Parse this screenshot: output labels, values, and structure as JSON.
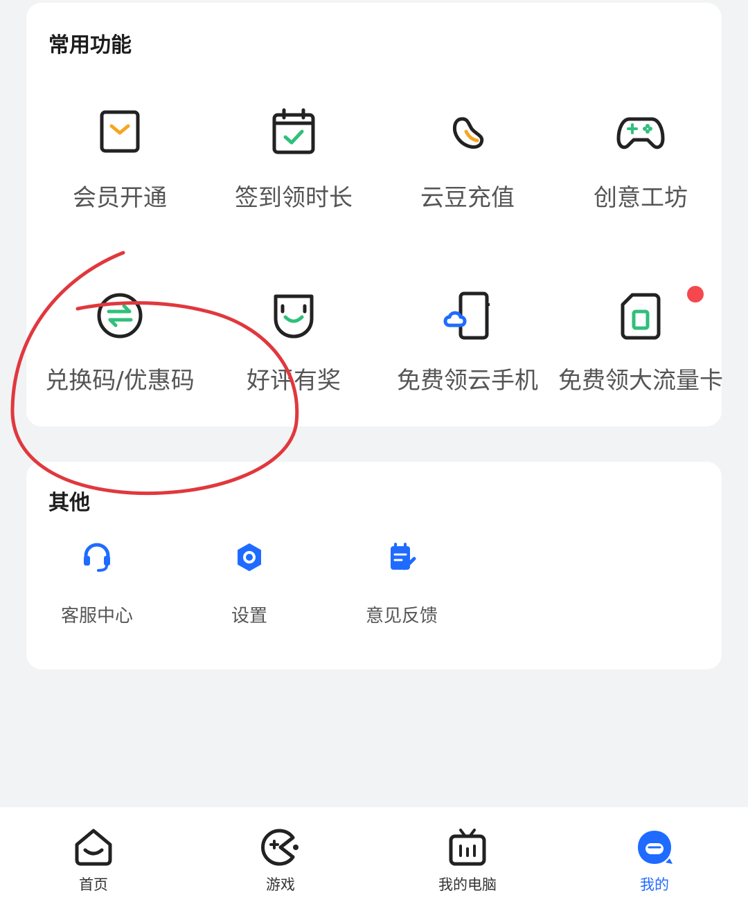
{
  "common": {
    "title": "常用功能",
    "items": [
      {
        "label": "会员开通",
        "icon": "vip-icon"
      },
      {
        "label": "签到领时长",
        "icon": "calendar-check-icon"
      },
      {
        "label": "云豆充值",
        "icon": "bean-icon"
      },
      {
        "label": "创意工坊",
        "icon": "gamepad-icon"
      },
      {
        "label": "兑换码/优惠码",
        "icon": "exchange-icon"
      },
      {
        "label": "好评有奖",
        "icon": "smile-icon"
      },
      {
        "label": "免费领云手机",
        "icon": "cloud-phone-icon"
      },
      {
        "label": "免费领大流量卡",
        "icon": "sim-card-icon"
      }
    ]
  },
  "other": {
    "title": "其他",
    "items": [
      {
        "label": "客服中心",
        "icon": "headset-icon"
      },
      {
        "label": "设置",
        "icon": "settings-icon"
      },
      {
        "label": "意见反馈",
        "icon": "feedback-icon"
      }
    ]
  },
  "tabbar": {
    "tabs": [
      {
        "label": "首页",
        "icon": "home-icon"
      },
      {
        "label": "游戏",
        "icon": "game-icon"
      },
      {
        "label": "我的电脑",
        "icon": "tv-icon"
      },
      {
        "label": "我的",
        "icon": "profile-icon"
      }
    ],
    "active_index": 3
  },
  "colors": {
    "background": "#f2f3f5",
    "card": "#ffffff",
    "icon_dark": "#222222",
    "accent_orange": "#f5a623",
    "accent_green": "#2fc07b",
    "accent_blue": "#1f6bff",
    "badge_red": "#f5474e",
    "annotation_red": "#e0383e"
  }
}
